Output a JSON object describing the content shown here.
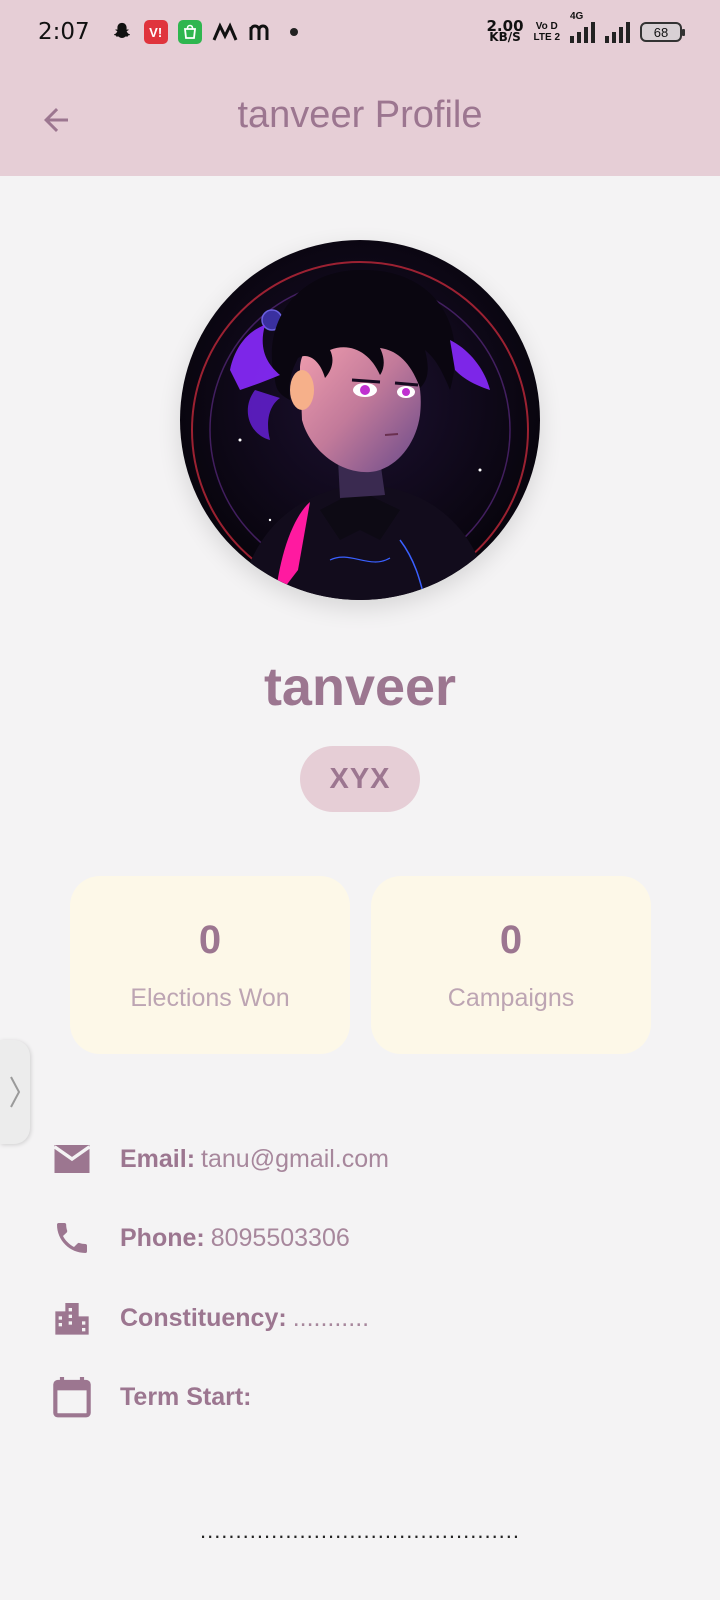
{
  "status_bar": {
    "time": "2:07",
    "net_speed_value": "2.00",
    "net_speed_unit": "KB/S",
    "volte_line1": "Vo D",
    "volte_line2": "LTE 2",
    "network_type": "4G",
    "battery": "68"
  },
  "app_bar": {
    "title": "tanveer Profile"
  },
  "profile": {
    "name": "tanveer",
    "badge": "XYX"
  },
  "stats": [
    {
      "value": "0",
      "label": "Elections Won"
    },
    {
      "value": "0",
      "label": "Campaigns"
    }
  ],
  "details": {
    "email_label": "Email:",
    "email_value": "tanu@gmail.com",
    "phone_label": "Phone:",
    "phone_value": "8095503306",
    "constituency_label": "Constituency:",
    "constituency_value": "...........",
    "term_label": "Term Start:",
    "term_value": ""
  },
  "footer": {
    "dots": "............................................."
  },
  "colors": {
    "primary": "#9c7690",
    "app_bar_bg": "#e6ced6",
    "card_bg": "#fdf8e8",
    "page_bg": "#f4f3f4"
  }
}
